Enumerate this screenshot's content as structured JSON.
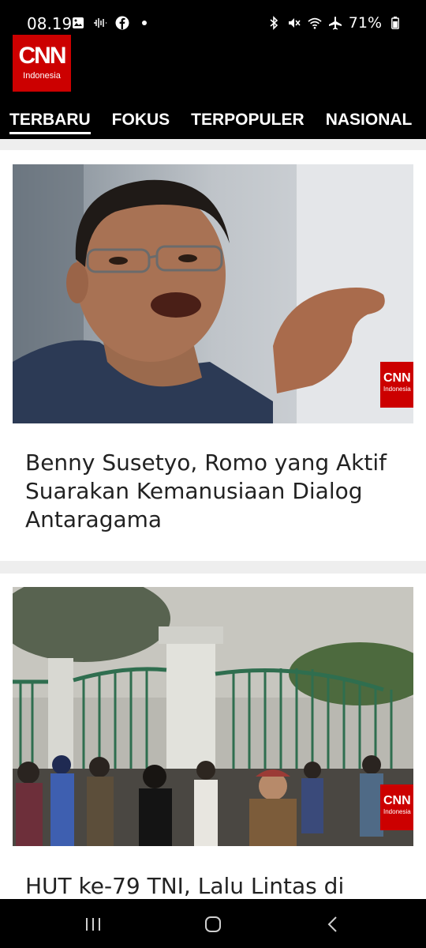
{
  "status": {
    "time": "08.19",
    "battery": "71%",
    "left_icons": [
      "gallery-icon",
      "audio-icon",
      "facebook-icon",
      "dot-icon"
    ],
    "right_icons": [
      "bluetooth-icon",
      "mute-icon",
      "wifi-icon",
      "airplane-icon",
      "battery-icon"
    ]
  },
  "brand": {
    "mark": "CNN",
    "sub": "Indonesia"
  },
  "tabs": [
    {
      "label": "TERBARU",
      "active": true
    },
    {
      "label": "FOKUS",
      "active": false
    },
    {
      "label": "TERPOPULER",
      "active": false
    },
    {
      "label": "NASIONAL",
      "active": false
    }
  ],
  "articles": [
    {
      "title": "Benny Susetyo, Romo yang Aktif Suarakan Kemanusiaan Dialog Antaragama",
      "watermark": "CNN",
      "watermark_sub": "Indonesia"
    },
    {
      "title": "HUT ke-79 TNI, Lalu Lintas di",
      "watermark": "CNN",
      "watermark_sub": "Indonesia"
    }
  ],
  "nav": [
    "recent-apps-icon",
    "home-icon",
    "back-icon"
  ]
}
